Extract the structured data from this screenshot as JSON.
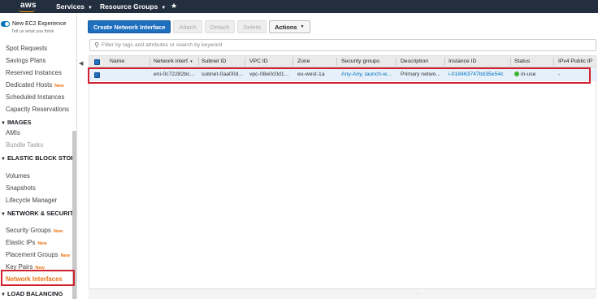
{
  "topbar": {
    "logo": "aws",
    "services": "Services",
    "resource_groups": "Resource Groups"
  },
  "sidebar": {
    "toggle_label": "New EC2 Experience",
    "toggle_sub": "Tell us what you think",
    "new_badge": "New",
    "links_top": [
      {
        "label": "Spot Requests"
      },
      {
        "label": "Savings Plans"
      },
      {
        "label": "Reserved Instances"
      },
      {
        "label": "Dedicated Hosts",
        "new": true
      },
      {
        "label": "Scheduled Instances"
      },
      {
        "label": "Capacity Reservations"
      }
    ],
    "sections": {
      "images": {
        "title": "IMAGES",
        "items": [
          "AMIs",
          "Bundle Tasks"
        ]
      },
      "ebs": {
        "title": "ELASTIC BLOCK STORE",
        "items": [
          "Volumes",
          "Snapshots",
          "Lifecycle Manager"
        ]
      },
      "network": {
        "title": "NETWORK & SECURITY",
        "items": [
          "Security Groups",
          "Elastic IPs",
          "Placement Groups",
          "Key Pairs"
        ],
        "active": "Network Interfaces"
      },
      "lb": {
        "title": "LOAD BALANCING"
      }
    }
  },
  "toolbar": {
    "create": "Create Network Interface",
    "attach": "Attach",
    "detach": "Detach",
    "delete": "Delete",
    "actions": "Actions"
  },
  "search": {
    "placeholder": "Filter by tags and attributes or search by keyword"
  },
  "table": {
    "columns": [
      "Name",
      "Network interf.",
      "Subnet ID",
      "VPC ID",
      "Zone",
      "Security groups",
      "Description",
      "Instance ID",
      "Status",
      "IPv4 Public IP"
    ],
    "rows": [
      {
        "name": "",
        "network_interface": "eni-0c72282bc...",
        "subnet_id": "subnet-0aa00d...",
        "vpc_id": "vpc-08e0c0d1...",
        "zone": "eu-west-1a",
        "security_groups": "Any-Any, launch-w...",
        "description": "Primary netwo...",
        "instance_id": "i-018463747bb35e54c",
        "status": "in-use",
        "ipv4": "-"
      }
    ]
  },
  "colors": {
    "topbar": "#232f3e",
    "primary": "#1f6fbf",
    "highlight": "#d0202e",
    "active_link": "#ec7211",
    "status_ok": "#3cb42d"
  }
}
